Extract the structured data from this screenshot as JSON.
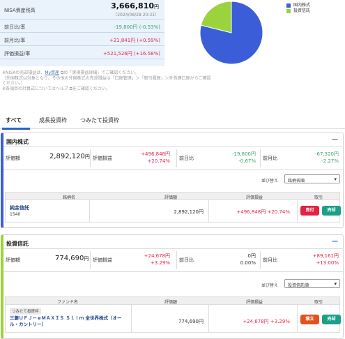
{
  "summary": {
    "title": "NISA資産残高",
    "total": "3,666,810",
    "total_unit": "円",
    "timestamp": "（2024/08/28 20:31）",
    "rows": [
      {
        "label": "前日比/率",
        "value": "-19,800円 (-0.53%)",
        "tone": "neg"
      },
      {
        "label": "前月比/率",
        "value": "+21,841円 (+0.59%)",
        "tone": "pos"
      },
      {
        "label": "評価損益/率",
        "value": "+521,526円 (+16.58%)",
        "tone": "pos"
      }
    ]
  },
  "pie": {
    "legend": [
      {
        "label": "国内株式",
        "color": "#3b5ed8",
        "share": 78.9
      },
      {
        "label": "投資信託",
        "color": "#9ad33c",
        "share": 21.1
      }
    ]
  },
  "notes": {
    "line1_a": "※NISAの売却損益は、",
    "line1_link": "My資産",
    "line1_b": "の「実現損益詳細」でご確認ください。",
    "line2": "（外国株式は対象となり、その他の外国株式の売却損益は「口座管理」＞「取引履歴」＞外貨建口座からご確認ください。）",
    "line3": "※各項目の計算式についてはヘルプ",
    "line3_b": "をご確認ください。"
  },
  "tabs": [
    "すべて",
    "成長投資枠",
    "つみたて投資枠"
  ],
  "domestic": {
    "title": "国内株式",
    "collapse": "−",
    "valuation_label": "評価額",
    "valuation": "2,892,120",
    "unit": "円",
    "pl_label": "評価損益",
    "pl_amount": "+496,848円",
    "pl_rate": "+20.74%",
    "day_label": "前日比",
    "day_amount": "-19,800円",
    "day_rate": "-0.67%",
    "month_label": "前月比",
    "month_amount": "-67,320円",
    "month_rate": "-2.27%",
    "sort_label": "並び替え",
    "sort_value": "銘柄名順",
    "headers": [
      "銘柄名",
      "評価額",
      "評価損益",
      "取引"
    ],
    "row": {
      "name": "純金信託",
      "code": "1540",
      "valuation": "2,892,120円",
      "pl_amount": "+496,848円",
      "pl_rate": "+20.74%",
      "buy": "買付",
      "sell": "売却"
    }
  },
  "fund": {
    "title": "投資信託",
    "collapse": "−",
    "valuation_label": "評価額",
    "valuation": "774,690",
    "unit": "円",
    "pl_label": "評価損益",
    "pl_amount": "+24,678円",
    "pl_rate": "+3.29%",
    "day_label": "前日比",
    "day_amount": "0円",
    "day_rate": "0.00%",
    "month_label": "前月比",
    "month_amount": "+89,161円",
    "month_rate": "+13.00%",
    "sort_label": "並び替え",
    "sort_value": "投資信託順",
    "headers": [
      "ファンド名",
      "評価額",
      "評価損益",
      "取引"
    ],
    "row": {
      "tag": "つみたて投資枠",
      "name": "三菱ＵＦＪ－ｅＭＡＸＩＳ Ｓｌｉｍ 全世界株式（オール・カントリー）",
      "valuation": "774,690円",
      "pl_amount": "+24,678円",
      "pl_rate": "+3.29%",
      "buy": "積立",
      "sell": "売却"
    }
  }
}
